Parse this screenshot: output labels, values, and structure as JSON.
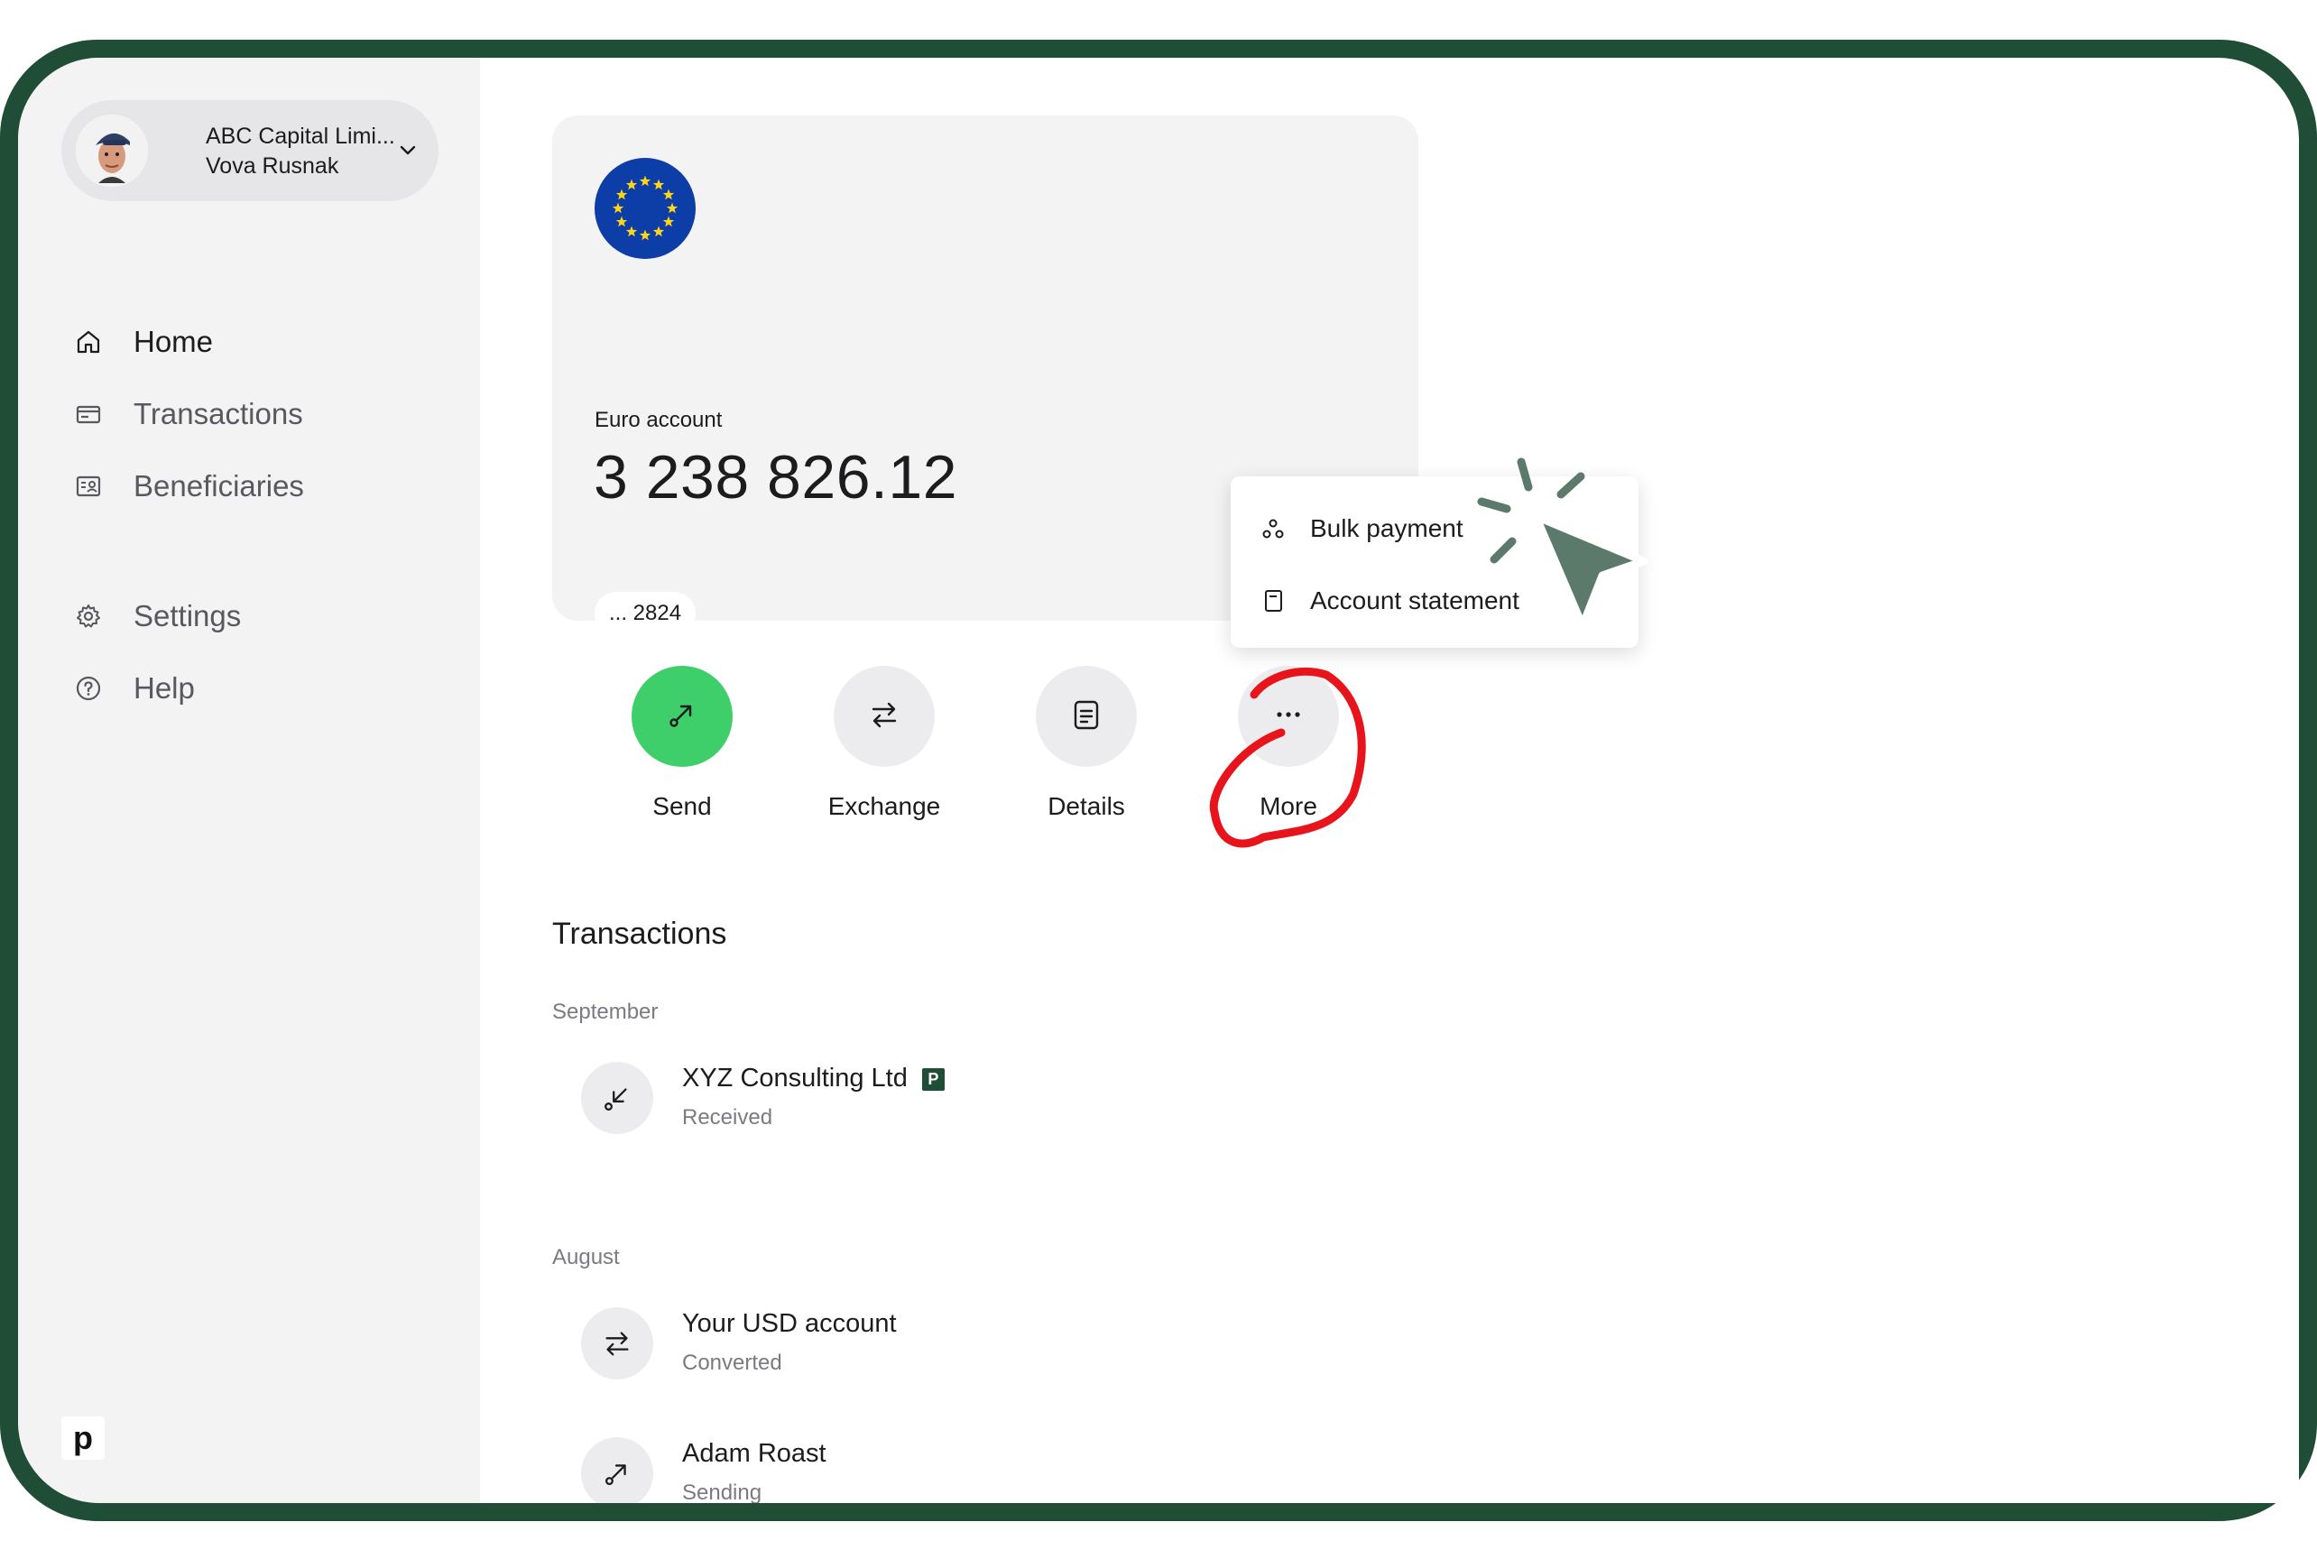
{
  "profile": {
    "company": "ABC Capital Limi...",
    "name": "Vova Rusnak"
  },
  "nav": {
    "home": "Home",
    "transactions": "Transactions",
    "beneficiaries": "Beneficiaries",
    "settings": "Settings",
    "help": "Help"
  },
  "brand": {
    "logo_letter": "p"
  },
  "account": {
    "label": "Euro account",
    "balance": "3 238 826.12",
    "number": "... 2824",
    "flag": "eu-flag"
  },
  "actions": {
    "send": "Send",
    "exchange": "Exchange",
    "details": "Details",
    "more": "More"
  },
  "more_menu": {
    "bulk_payment": "Bulk payment",
    "account_statement": "Account statement"
  },
  "transactions": {
    "title": "Transactions",
    "groups": [
      {
        "month": "September",
        "items": [
          {
            "name": "XYZ Consulting Ltd",
            "badge": "P",
            "status": "Received",
            "icon": "arrow-down-left-icon"
          }
        ]
      },
      {
        "month": "August",
        "items": [
          {
            "name": "Your USD account",
            "status": "Converted",
            "icon": "exchange-icon"
          },
          {
            "name": "Adam Roast",
            "status": "Sending",
            "icon": "arrow-up-right-icon"
          }
        ]
      }
    ]
  },
  "colors": {
    "frame": "#1f4d35",
    "sidebar_bg": "#f3f3f4",
    "send_green": "#3ecf6b",
    "annotation_red": "#e8141b",
    "cursor_green": "#5c7a6b",
    "eu_blue": "#0d3ea7"
  }
}
